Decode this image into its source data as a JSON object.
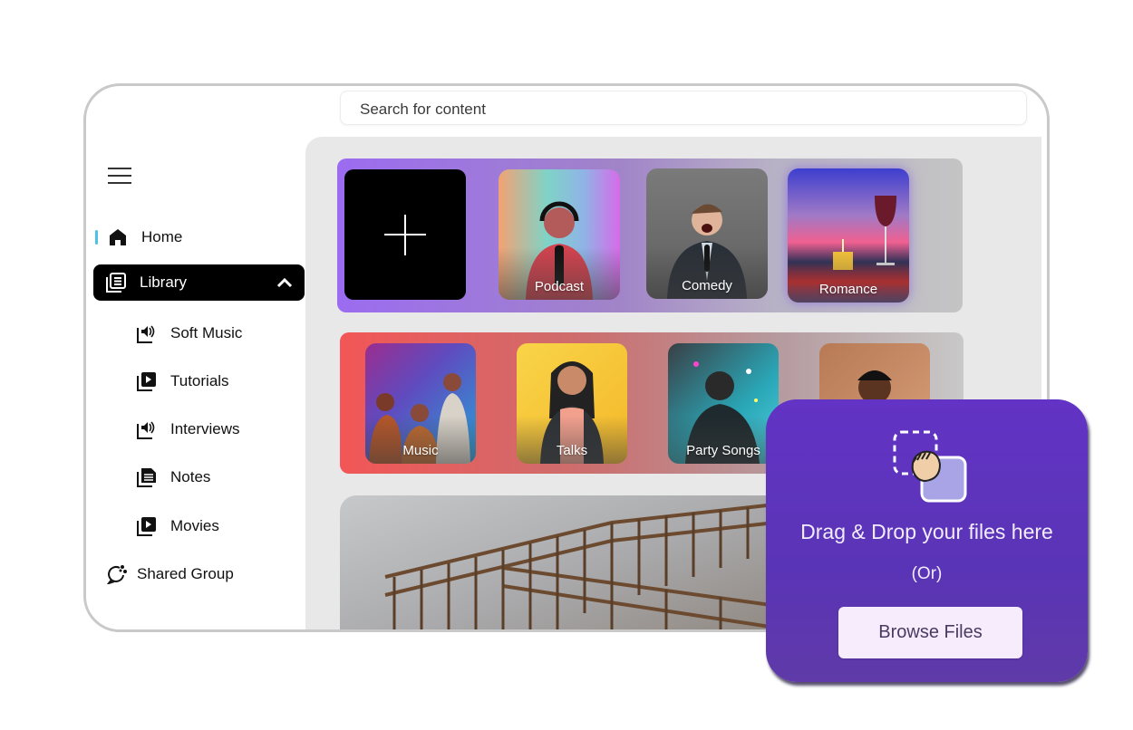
{
  "search": {
    "placeholder": "Search for content"
  },
  "sidebar": {
    "menu_icon": "hamburger-icon",
    "home": {
      "label": "Home",
      "icon": "home-icon",
      "active_indicator_color": "#4cc3e6"
    },
    "library": {
      "label": "Library",
      "icon": "library-icon",
      "expanded": true
    },
    "library_items": [
      {
        "label": "Soft Music",
        "icon": "audio-library-icon"
      },
      {
        "label": "Tutorials",
        "icon": "video-library-icon"
      },
      {
        "label": "Interviews",
        "icon": "audio-library-icon"
      },
      {
        "label": "Notes",
        "icon": "document-library-icon"
      },
      {
        "label": "Movies",
        "icon": "video-library-icon"
      }
    ],
    "shared_group": {
      "label": "Shared Group",
      "icon": "share-chat-icon"
    }
  },
  "rows": [
    {
      "tiles": [
        "Podcast",
        "Comedy",
        "Romance"
      ],
      "has_add_tile": true
    },
    {
      "tiles": [
        "Music",
        "Talks",
        "Party Songs",
        ""
      ]
    }
  ],
  "dropzone": {
    "title": "Drag & Drop your files here",
    "or": "(Or)",
    "button": "Browse Files",
    "accent": "#5e35b8"
  }
}
